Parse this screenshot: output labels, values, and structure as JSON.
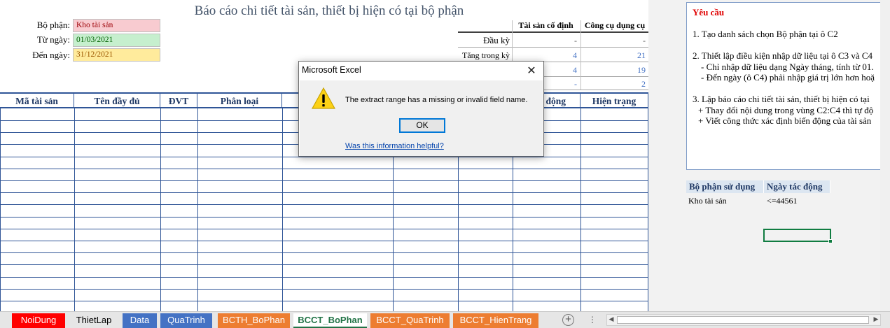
{
  "report": {
    "title": "Báo cáo chi tiết tài sản, thiết bị hiện có tại bộ phận",
    "labels": {
      "department": "Bộ phận:",
      "from_date": "Từ ngày:",
      "to_date": "Đến ngày:"
    },
    "values": {
      "department": "Kho tài sản",
      "from_date": "01/03/2021",
      "to_date": "31/12/2021"
    }
  },
  "summary": {
    "headers": [
      "Tài sản cố định",
      "Công cụ dụng cụ"
    ],
    "rows": [
      {
        "label": "Đầu kỳ",
        "fixed": "-",
        "tools": "-"
      },
      {
        "label": "Tăng trong kỳ",
        "fixed": "4",
        "tools": "21"
      },
      {
        "label": "",
        "fixed": "4",
        "tools": "19"
      },
      {
        "label": "",
        "fixed": "-",
        "tools": "2"
      }
    ]
  },
  "table": {
    "headers": [
      "Mã tài sản",
      "Tên đầy đủ",
      "ĐVT",
      "Phân loại",
      "",
      "",
      "",
      "động",
      "Hiện trạng"
    ]
  },
  "requirements": {
    "title": "Yêu cầu",
    "lines": [
      "1. Tạo danh sách chọn Bộ phận tại ô C2",
      "2. Thiết lập điều kiện nhập dữ liệu tại ô C3 và C4",
      "- Chỉ nhập dữ liệu dạng Ngày tháng, tính từ 01.",
      "- Đến ngày (ô C4) phải nhập giá trị lớn hơn hoặ",
      "3. Lập báo cáo chi tiết tài sản, thiết bị hiện có tại",
      "+ Thay đổi nội dung trong vùng C2:C4 thì tự độ",
      "+ Viết công thức xác định biến động của tài sản"
    ]
  },
  "criteria": {
    "headers": [
      "Bộ phận sử dụng",
      "Ngày tác động"
    ],
    "values": [
      "Kho tài sản",
      "<=44561"
    ]
  },
  "dialog": {
    "title": "Microsoft Excel",
    "close": "✕",
    "message": "The extract range has a missing or invalid field name.",
    "ok_label": "OK",
    "help_link": "Was this information helpful?",
    "icon": "warning-icon"
  },
  "tabs": [
    {
      "label": "NoiDung",
      "color": "#ff0000"
    },
    {
      "label": "ThietLap",
      "color": "#e6e6e6"
    },
    {
      "label": "Data",
      "color": "#4472c4"
    },
    {
      "label": "QuaTrinh",
      "color": "#4472c4"
    },
    {
      "label": "BCTH_BoPhan",
      "color": "#ed7d31"
    },
    {
      "label": "BCCT_BoPhan",
      "color": "#ffffff",
      "active": true
    },
    {
      "label": "BCCT_QuaTrinh",
      "color": "#ed7d31"
    },
    {
      "label": "BCCT_HienTrang",
      "color": "#ed7d31"
    }
  ],
  "add_sheet_label": "+",
  "more_tabs_label": "⋮"
}
